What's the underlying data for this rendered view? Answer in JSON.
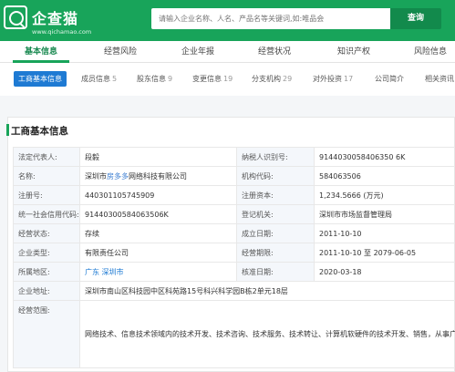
{
  "header": {
    "brand": "企查猫",
    "brand_url": "www.qichamao.com",
    "search_placeholder": "请输入企业名称、人名、产品名等关键词,如:唯品会",
    "search_button": "查询"
  },
  "nav_tabs": [
    "基本信息",
    "经营风险",
    "企业年报",
    "经营状况",
    "知识产权",
    "风险信息"
  ],
  "sub_tabs": [
    {
      "label": "工商基本信息",
      "count": ""
    },
    {
      "label": "成员信息",
      "count": "5"
    },
    {
      "label": "股东信息",
      "count": "9"
    },
    {
      "label": "变更信息",
      "count": "19"
    },
    {
      "label": "分支机构",
      "count": "29"
    },
    {
      "label": "对外投资",
      "count": "17"
    },
    {
      "label": "公司简介",
      "count": ""
    },
    {
      "label": "相关资讯",
      "count": ""
    }
  ],
  "section_title": "工商基本信息",
  "info": {
    "legal_rep_label": "法定代表人:",
    "legal_rep": "段毅",
    "taxpayer_label": "纳税人识别号:",
    "taxpayer": "9144030058406350 6K",
    "name_label": "名称:",
    "name_pre": "深圳市",
    "name_hl": "房多多",
    "name_post": "网络科技有限公司",
    "org_code_label": "机构代码:",
    "org_code": "584063506",
    "reg_no_label": "注册号:",
    "reg_no": "440301105745909",
    "reg_cap_label": "注册资本:",
    "reg_cap": "1,234.5666 (万元)",
    "credit_label": "统一社会信用代码:",
    "credit": "91440300584063506K",
    "authority_label": "登记机关:",
    "authority": "深圳市市场监督管理局",
    "status_label": "经营状态:",
    "status": "存续",
    "founded_label": "成立日期:",
    "founded": "2011-10-10",
    "type_label": "企业类型:",
    "type": "有限责任公司",
    "term_label": "经营期限:",
    "term": "2011-10-10 至 2079-06-05",
    "region_label": "所属地区:",
    "region_province": "广东",
    "region_city": "深圳市",
    "approved_label": "核准日期:",
    "approved": "2020-03-18",
    "address_label": "企业地址:",
    "address": "深圳市南山区科技园中区科苑路15号科兴科学园B栋2单元18层",
    "scope_label": "经营范围:",
    "scope": "网络技术、信息技术领域内的技术开发、技术咨询、技术服务、技术转让、计算机软硬件的技术开发、销售，从事广告业务，市场营销策划，商务信息咨询，房地产经纪、投资咨询，计算机网络产品技术开发、销售，国内贸易，礼品的批发、销售，物业管理、物业租赁；动漫设计;影视剧相关活动宣传策划。（以上项目法律、行政法规、国务院决定规定在登记前须经批准的项目除外，限制的项目须取得许可后方可经营）"
  },
  "colors": {
    "brand_green": "#18a45a",
    "link_blue": "#1e7ad3"
  }
}
